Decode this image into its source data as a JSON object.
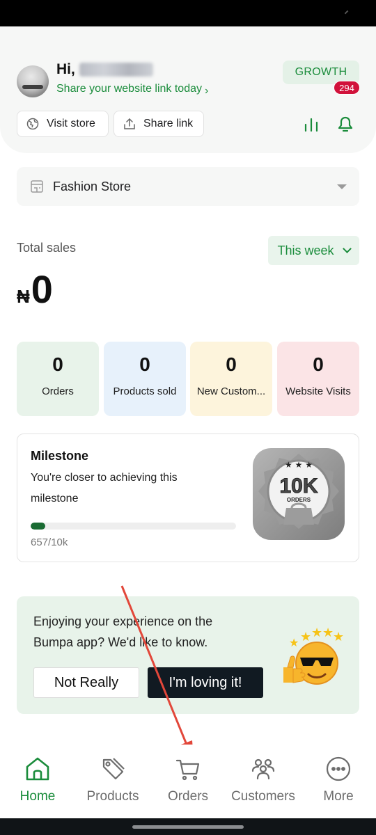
{
  "header": {
    "greeting": "Hi,",
    "share_hint": "Share your website link today",
    "plan_badge": "GROWTH",
    "visit_store_label": "Visit store",
    "share_link_label": "Share link",
    "notification_count": "294"
  },
  "store": {
    "name": "Fashion Store"
  },
  "sales": {
    "label": "Total sales",
    "period": "This week",
    "currency": "₦",
    "amount": "0"
  },
  "metrics": [
    {
      "value": "0",
      "label": "Orders"
    },
    {
      "value": "0",
      "label": "Products sold"
    },
    {
      "value": "0",
      "label": "New Custom..."
    },
    {
      "value": "0",
      "label": "Website Visits"
    }
  ],
  "milestone": {
    "title": "Milestone",
    "description": "You're closer to achieving this milestone",
    "progress_text": "657/10k",
    "progress_fraction": 0.0657,
    "badge_main": "10K",
    "badge_sub": "ORDERS"
  },
  "feedback": {
    "question": "Enjoying your experience on the Bumpa app? We'd like to know.",
    "no_label": "Not Really",
    "yes_label": "I'm loving it!"
  },
  "tabs": [
    {
      "label": "Home",
      "icon": "home-icon",
      "active": true
    },
    {
      "label": "Products",
      "icon": "tag-icon",
      "active": false
    },
    {
      "label": "Orders",
      "icon": "cart-icon",
      "active": false
    },
    {
      "label": "Customers",
      "icon": "customers-icon",
      "active": false
    },
    {
      "label": "More",
      "icon": "more-icon",
      "active": false
    }
  ],
  "colors": {
    "brand_green": "#1a8c3b",
    "alert_red": "#d1123b",
    "annotation_arrow": "#e2473a"
  }
}
